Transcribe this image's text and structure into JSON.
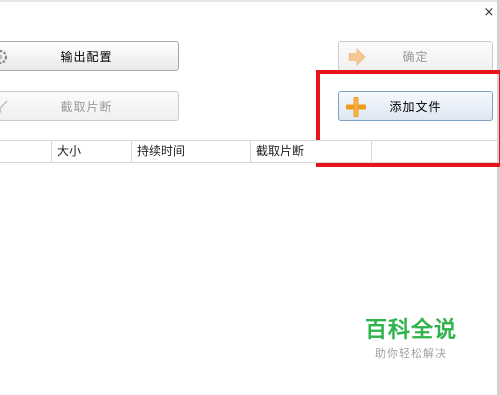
{
  "window": {
    "close_glyph": "×"
  },
  "toolbar": {
    "output_config_label": "输出配置",
    "clip_segment_label": "截取片断",
    "confirm_label": "确定",
    "add_file_label": "添加文件"
  },
  "icons": {
    "gear": "gear-icon",
    "scissors": "scissors-icon",
    "arrow": "arrow-right-icon",
    "plus": "plus-icon"
  },
  "table": {
    "columns": [
      "",
      "大小",
      "持续时间",
      "截取片断",
      ""
    ]
  },
  "watermark": {
    "title": "百科全说",
    "subtitle": "助你轻松解决"
  },
  "colors": {
    "highlight": "#e8141b",
    "plus": "#f39a1e",
    "watermark": "#2fb34a"
  }
}
